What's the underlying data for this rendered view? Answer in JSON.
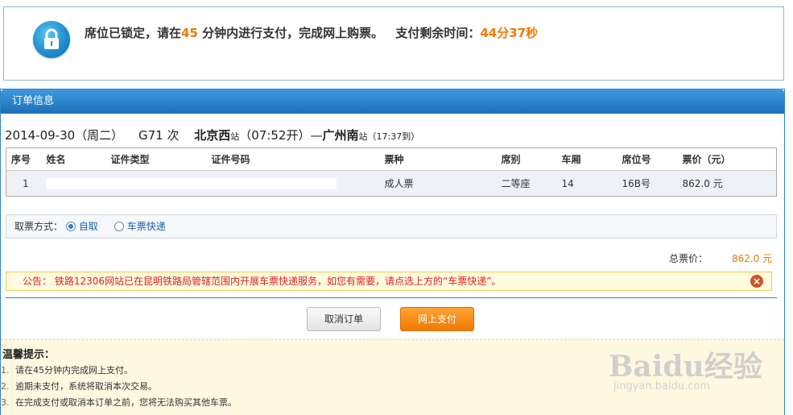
{
  "lock_banner": {
    "msg_prefix": "席位已锁定，请在",
    "minutes": "45",
    "msg_suffix": " 分钟内进行支付，完成网上购票。",
    "remain_label": "支付剩余时间：",
    "remain_time": "44分37秒",
    "icon": "lock-icon"
  },
  "panel": {
    "title": "订单信息"
  },
  "trip": {
    "date": "2014-09-30（周二）",
    "train": "G71 次",
    "from": "北京西",
    "from_suffix": "站",
    "depart": "（07:52开）",
    "dash": "—",
    "to": "广州南",
    "to_suffix": "站",
    "arrive": "（17:37到）"
  },
  "table": {
    "headers": [
      "序号",
      "姓名",
      "证件类型",
      "证件号码",
      "票种",
      "席别",
      "车厢",
      "席位号",
      "票价（元）"
    ],
    "rows": [
      {
        "no": "1",
        "ticket_type": "成人票",
        "seat_class": "二等座",
        "car": "14",
        "seat_no": "16B号",
        "price": "862.0 元"
      }
    ]
  },
  "pickup": {
    "label": "取票方式：",
    "options": [
      "自取",
      "车票快递"
    ],
    "selected": "自取"
  },
  "total": {
    "label": "总票价：",
    "value": "862.0 元"
  },
  "notice": {
    "text": "公告： 铁路12306网站已在昆明铁路局管辖范围内开展车票快递服务，如您有需要，请点选上方的“车票快递”。",
    "close": "×"
  },
  "buttons": {
    "cancel": "取消订单",
    "pay": "网上支付"
  },
  "tips": {
    "title": "温馨提示：",
    "items": [
      "请在45分钟内完成网上支付。",
      "逾期未支付，系统将取消本次交易。",
      "在完成支付或取消本订单之前，您将无法购买其他车票。"
    ]
  },
  "watermark": {
    "logo": "Baidu经验",
    "url": "jingyan.baidu.com"
  },
  "colors": {
    "accent": "#2f85c6",
    "orange": "#f07a00",
    "notice_red": "#dd2222"
  }
}
